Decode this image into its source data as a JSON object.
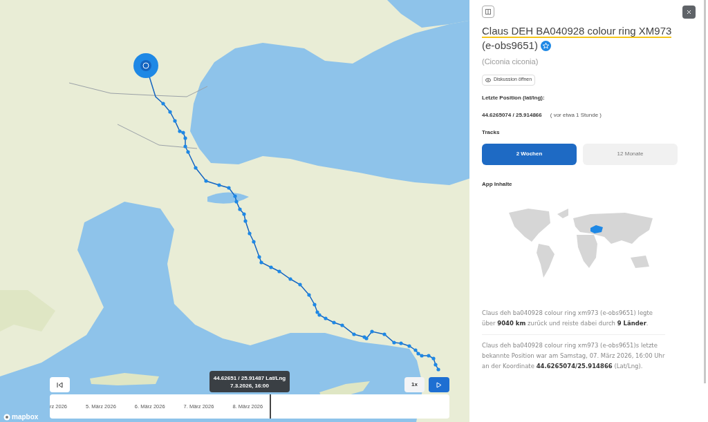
{
  "map": {
    "attribution": "mapbox",
    "timeline": {
      "ticks": [
        "rz 2026",
        "5. März 2026",
        "6. März 2026",
        "7. März 2026",
        "8. März 2026"
      ],
      "tooltip": {
        "coords": "44.62651 / 25.91487 Lat/Lng",
        "time": "7.3.2026, 16:00"
      },
      "speed": "1x"
    }
  },
  "panel": {
    "name": "Claus DEH BA040928 colour ring XM973",
    "tag": "(e-obs9651)",
    "favorite": true,
    "species": "(Ciconia ciconia)",
    "discussion_button": "Diskussion öffnen",
    "position_label": "Letzte Position (lat/lng):",
    "position": "44.6265074 / 25.914866",
    "position_age": "( vor etwa 1 Stunde )",
    "tracks_label": "Tracks",
    "tracks": [
      {
        "label": "2 Wochen",
        "selected": true
      },
      {
        "label": "12 Monate",
        "selected": false
      }
    ],
    "content_label": "App Inhalte",
    "summaries": [
      "Claus deh ba040928 colour ring xm973 (e-obs9651) legte über **9040 km** zurück und reiste dabei durch **9 Länder**.",
      "Claus deh ba040928 colour ring xm973 (e-obs9651)s letzte bekannte Position war am Samstag, 07. März 2026, 16:00 Uhr an der Koordinate **44.6265074/25.914866** (Lat/Lng)."
    ]
  }
}
